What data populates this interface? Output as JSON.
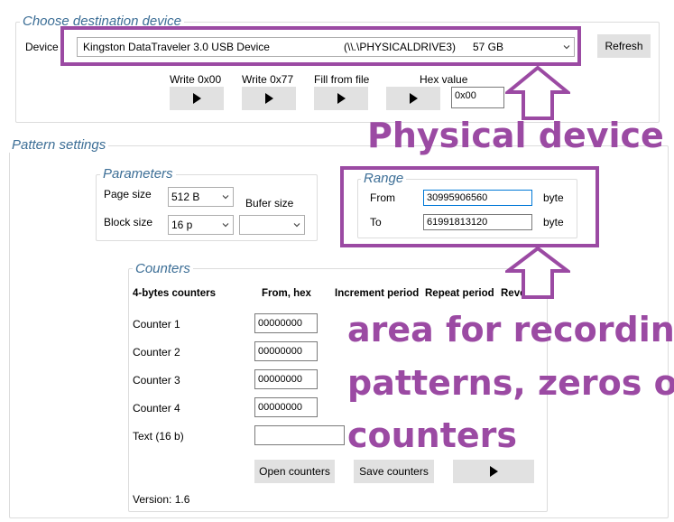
{
  "destination": {
    "legend": "Choose destination device",
    "device_label": "Device",
    "device_name": "Kingston DataTraveler 3.0 USB Device",
    "device_path": "(\\\\.\\PHYSICALDRIVE3)",
    "device_size": "57 GB",
    "refresh_label": "Refresh",
    "write_00_label": "Write 0x00",
    "write_77_label": "Write 0x77",
    "fill_from_file_label": "Fill from file",
    "hex_value_label": "Hex value",
    "hex_value": "0x00"
  },
  "pattern": {
    "legend": "Pattern settings",
    "parameters": {
      "legend": "Parameters",
      "page_size_label": "Page size",
      "page_size_value": "512 B",
      "buffer_size_label": "Bufer size",
      "buffer_size_value": "",
      "block_size_label": "Block size",
      "block_size_value": "16 p"
    },
    "range": {
      "legend": "Range",
      "from_label": "From",
      "from_value": "30995906560",
      "to_label": "To",
      "to_value": "61991813120",
      "unit_from": "byte",
      "unit_to": "byte"
    }
  },
  "counters": {
    "legend": "Counters",
    "headers": [
      "4-bytes counters",
      "From, hex",
      "Increment period",
      "Repeat period",
      "Reve"
    ],
    "rows": [
      {
        "label": "Counter 1",
        "value": "00000000"
      },
      {
        "label": "Counter 2",
        "value": "00000000"
      },
      {
        "label": "Counter 3",
        "value": "00000000"
      },
      {
        "label": "Counter 4",
        "value": "00000000"
      }
    ],
    "text_label": "Text (16 b)",
    "text_value": "",
    "open_label": "Open counters",
    "save_label": "Save counters",
    "version": "Version: 1.6"
  },
  "annotations": {
    "physical_device": "Physical device",
    "area_line1": "area for recording",
    "area_line2": "patterns, zeros or",
    "area_line3": "counters"
  },
  "colors": {
    "annotation": "#9b4aa3",
    "legend_text": "#3c6e96",
    "button_bg": "#e1e1e1"
  },
  "icons": {
    "play": "play-icon",
    "dropdown": "chevron-down-icon",
    "arrow": "up-arrow-outline"
  }
}
